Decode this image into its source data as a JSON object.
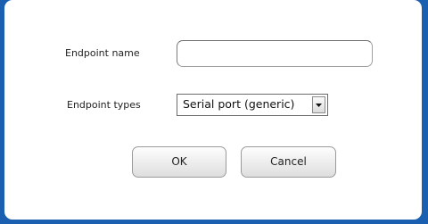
{
  "form": {
    "endpoint_name_label": "Endpoint name",
    "endpoint_name_value": "",
    "endpoint_types_label": "Endpoint types",
    "endpoint_types_selected": "Serial port (generic)"
  },
  "buttons": {
    "ok_label": "OK",
    "cancel_label": "Cancel"
  },
  "icons": {
    "dropdown": "dropdown-arrow-icon"
  },
  "colors": {
    "frame_accent": "#1a5fb0",
    "panel_background": "#ffffff"
  }
}
